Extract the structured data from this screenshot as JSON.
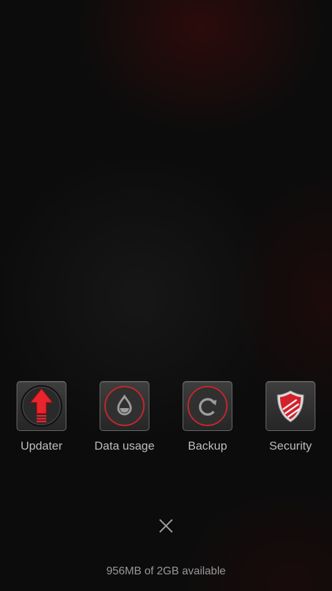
{
  "apps": [
    {
      "label": "Updater",
      "icon": "updater-arrow-icon"
    },
    {
      "label": "Data usage",
      "icon": "data-usage-drop-icon"
    },
    {
      "label": "Backup",
      "icon": "backup-refresh-icon"
    },
    {
      "label": "Security",
      "icon": "security-shield-icon"
    }
  ],
  "close": {
    "icon": "close-icon"
  },
  "memory": {
    "text": "956MB of 2GB available"
  },
  "colors": {
    "accent": "#e0202a",
    "label": "#bdbdbd",
    "tile_border": "#6b6b6b"
  }
}
